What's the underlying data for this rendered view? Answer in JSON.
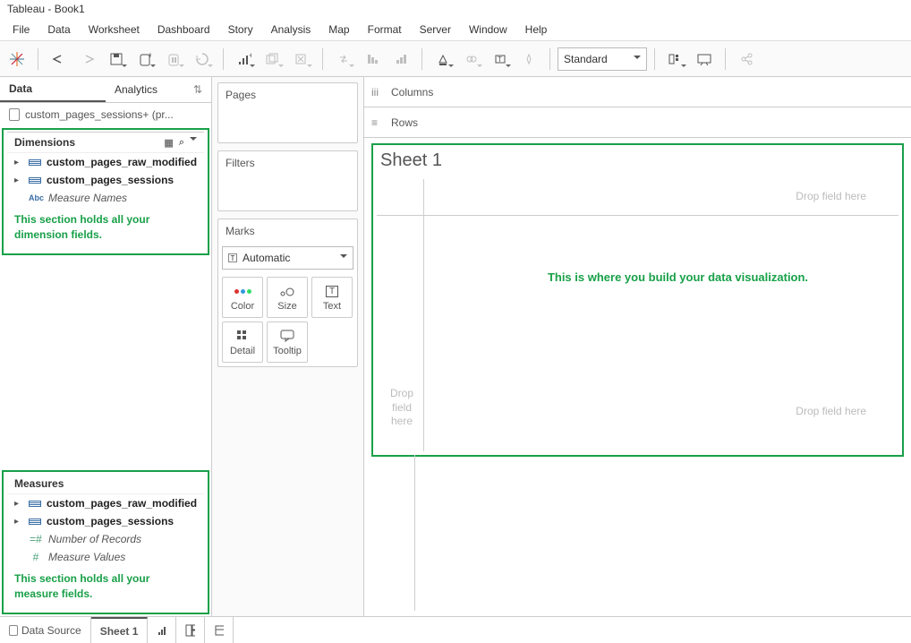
{
  "title": "Tableau - Book1",
  "menu": [
    "File",
    "Data",
    "Worksheet",
    "Dashboard",
    "Story",
    "Analysis",
    "Map",
    "Format",
    "Server",
    "Window",
    "Help"
  ],
  "fit_mode": "Standard",
  "sidepane": {
    "tab_data": "Data",
    "tab_analytics": "Analytics",
    "datasource": "custom_pages_sessions+ (pr...",
    "dimensions_label": "Dimensions",
    "dim_items": [
      {
        "label": "custom_pages_raw_modified",
        "type": "table"
      },
      {
        "label": "custom_pages_sessions",
        "type": "table"
      },
      {
        "label": "Measure Names",
        "type": "abc"
      }
    ],
    "dim_annot": "This section holds all your dimension fields.",
    "measures_label": "Measures",
    "meas_items": [
      {
        "label": "custom_pages_raw_modified",
        "type": "table"
      },
      {
        "label": "custom_pages_sessions",
        "type": "table"
      },
      {
        "label": "Number of Records",
        "type": "hash"
      },
      {
        "label": "Measure Values",
        "type": "hash"
      }
    ],
    "meas_annot": "This section holds all your measure fields."
  },
  "cards": {
    "pages": "Pages",
    "filters": "Filters",
    "marks": "Marks",
    "marks_select": "Automatic",
    "mark_btns": [
      "Color",
      "Size",
      "Text",
      "Detail",
      "Tooltip"
    ]
  },
  "shelves": {
    "columns": "Columns",
    "rows": "Rows"
  },
  "viz": {
    "sheet_title": "Sheet 1",
    "drop_field": "Drop field here",
    "drop_field_stack": "Drop\nfield\nhere",
    "annotation": "This is where you build your data visualization."
  },
  "bottom": {
    "data_source": "Data Source",
    "sheet_tab": "Sheet 1"
  }
}
